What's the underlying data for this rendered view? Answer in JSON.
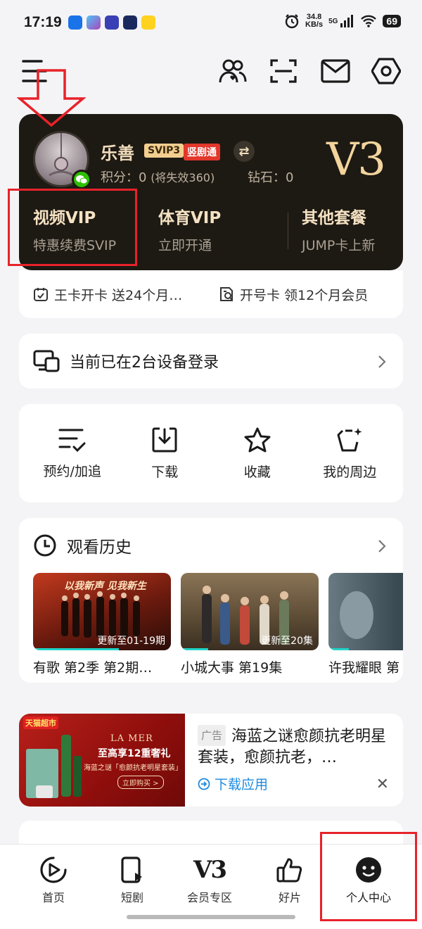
{
  "status": {
    "time": "17:19",
    "net_speed_top": "34.8",
    "net_speed_unit": "KB/s",
    "network": "5G",
    "battery": "69"
  },
  "profile": {
    "username": "乐善",
    "svip_badge": "SVIP3",
    "short_badge": "竖剧通",
    "points_label": "积分：",
    "points_value": "0",
    "points_note": "(将失效360)",
    "diamonds_label": "钻石：",
    "diamonds_value": "0",
    "level": "V3",
    "packages": [
      {
        "title": "视频VIP",
        "subtitle": "特惠续费SVIP"
      },
      {
        "title": "体育VIP",
        "subtitle": "立即开通"
      },
      {
        "title": "其他套餐",
        "subtitle": "JUMP卡上新"
      }
    ]
  },
  "promos": [
    {
      "icon": "calendar-check-icon",
      "text": "王卡开卡 送24个月…"
    },
    {
      "icon": "sim-card-icon",
      "text": "开号卡 领12个月会员"
    }
  ],
  "devices": {
    "text": "当前已在2台设备登录"
  },
  "quick_actions": [
    {
      "icon": "reservation-icon",
      "label": "预约/加追"
    },
    {
      "icon": "download-icon",
      "label": "下载"
    },
    {
      "icon": "star-icon",
      "label": "收藏"
    },
    {
      "icon": "merch-icon",
      "label": "我的周边"
    }
  ],
  "history": {
    "title": "观看历史",
    "items": [
      {
        "name": "有歌 第2季 第2期…",
        "update": "更新至01-19期",
        "poster_text": "以我新声 见我新生",
        "progress": 0.62
      },
      {
        "name": "小城大事 第19集",
        "update": "更新至20集",
        "progress": 0.2
      },
      {
        "name": "许我耀眼 第",
        "update": "",
        "progress": 0.15
      }
    ]
  },
  "ad": {
    "tag": "广告",
    "title": "海蓝之谜愈颜抗老明星套装，愈颜抗老，…",
    "download": "下载应用",
    "image_brand": "LA MER",
    "image_headline": "至高享12重奢礼",
    "image_sub": "海蓝之谜「愈颜抗老明星套装」",
    "image_button": "立即购买 >",
    "image_corner": "天猫超市"
  },
  "bottom_nav": [
    {
      "icon": "play-circle-icon",
      "label": "首页"
    },
    {
      "icon": "short-drama-icon",
      "label": "短剧"
    },
    {
      "icon": "v3-icon",
      "label": "会员专区",
      "glyph": "V3"
    },
    {
      "icon": "thumbs-up-icon",
      "label": "好片"
    },
    {
      "icon": "smile-face-icon",
      "label": "个人中心"
    }
  ],
  "colors": {
    "accent_red": "#e8222a",
    "vip_gold": "#f2d49c",
    "card_dark": "#1d1913",
    "link_blue": "#1e8be0"
  }
}
